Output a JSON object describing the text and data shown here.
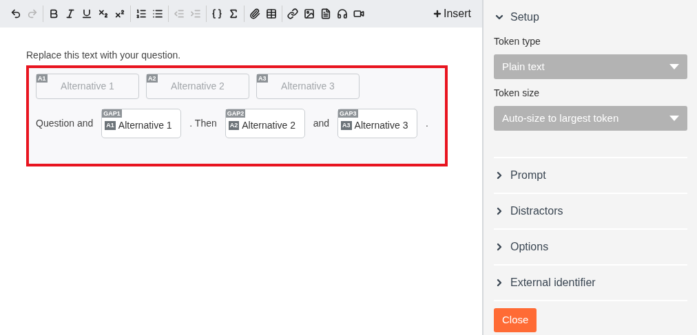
{
  "toolbar": {
    "groups": [
      [
        {
          "kind": "undo",
          "disabled": false
        },
        {
          "kind": "redo",
          "disabled": true
        }
      ],
      [
        {
          "kind": "bold",
          "disabled": false
        },
        {
          "kind": "italic",
          "disabled": false
        },
        {
          "kind": "underline",
          "disabled": false
        },
        {
          "kind": "subscript",
          "disabled": false
        },
        {
          "kind": "superscript",
          "disabled": false
        }
      ],
      [
        {
          "kind": "ordered-list",
          "disabled": false
        },
        {
          "kind": "bullet-list",
          "disabled": false
        }
      ],
      [
        {
          "kind": "outdent",
          "disabled": true
        },
        {
          "kind": "indent",
          "disabled": true
        }
      ],
      [
        {
          "kind": "braces",
          "disabled": false
        },
        {
          "kind": "sigma",
          "disabled": false
        }
      ],
      [
        {
          "kind": "attachment",
          "disabled": false
        },
        {
          "kind": "table",
          "disabled": false
        }
      ],
      [
        {
          "kind": "link",
          "disabled": false
        },
        {
          "kind": "image",
          "disabled": false
        },
        {
          "kind": "pdf",
          "disabled": false
        },
        {
          "kind": "audio",
          "disabled": false
        },
        {
          "kind": "video",
          "disabled": false
        }
      ]
    ],
    "insert_label": "Insert"
  },
  "question": "Replace this text with your question.",
  "alternatives": [
    {
      "tag": "A1",
      "text": "Alternative 1"
    },
    {
      "tag": "A2",
      "text": "Alternative 2"
    },
    {
      "tag": "A3",
      "text": "Alternative 3"
    }
  ],
  "sentence": [
    {
      "kind": "text",
      "text": "Question and"
    },
    {
      "kind": "gap",
      "tag": "GAP1",
      "token_tag": "A1",
      "token_text": "Alternative 1"
    },
    {
      "kind": "text",
      "text": ". Then"
    },
    {
      "kind": "gap",
      "tag": "GAP2",
      "token_tag": "A2",
      "token_text": "Alternative 2"
    },
    {
      "kind": "text",
      "text": "and"
    },
    {
      "kind": "gap",
      "tag": "GAP3",
      "token_tag": "A3",
      "token_text": "Alternative 3"
    },
    {
      "kind": "text",
      "text": "."
    }
  ],
  "panel": {
    "sections": [
      {
        "title": "Setup",
        "expanded": true,
        "fields": [
          {
            "label": "Token type",
            "value": "Plain text"
          },
          {
            "label": "Token size",
            "value": "Auto-size to largest token"
          }
        ]
      },
      {
        "title": "Prompt",
        "expanded": false
      },
      {
        "title": "Distractors",
        "expanded": false
      },
      {
        "title": "Options",
        "expanded": false
      },
      {
        "title": "External identifier",
        "expanded": false
      }
    ],
    "close_label": "Close"
  }
}
